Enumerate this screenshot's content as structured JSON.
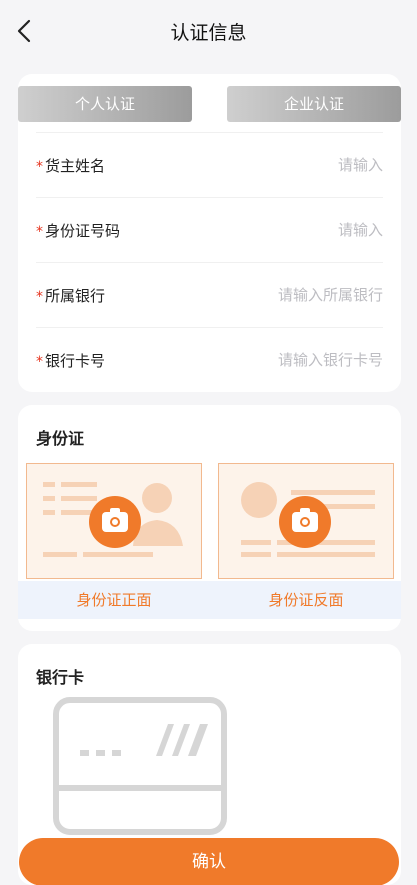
{
  "header": {
    "title": "认证信息"
  },
  "tabs": {
    "personal": "个人认证",
    "company": "企业认证"
  },
  "form": {
    "required_mark": "*",
    "fields": [
      {
        "label": "货主姓名",
        "placeholder": "请输入",
        "value": ""
      },
      {
        "label": "身份证号码",
        "placeholder": "请输入",
        "value": ""
      },
      {
        "label": "所属银行",
        "placeholder": "请输入所属银行",
        "value": ""
      },
      {
        "label": "银行卡号",
        "placeholder": "请输入银行卡号",
        "value": ""
      }
    ]
  },
  "id_card": {
    "title": "身份证",
    "front_label": "身份证正面",
    "back_label": "身份证反面"
  },
  "bank_card": {
    "title": "银行卡"
  },
  "footer": {
    "confirm_label": "确认"
  },
  "colors": {
    "accent": "#f07a2a",
    "required": "#e5331e",
    "placeholder": "#bdbdc2"
  },
  "icons": {
    "back": "chevron-left-icon",
    "camera": "camera-icon",
    "card": "bank-card-icon"
  }
}
